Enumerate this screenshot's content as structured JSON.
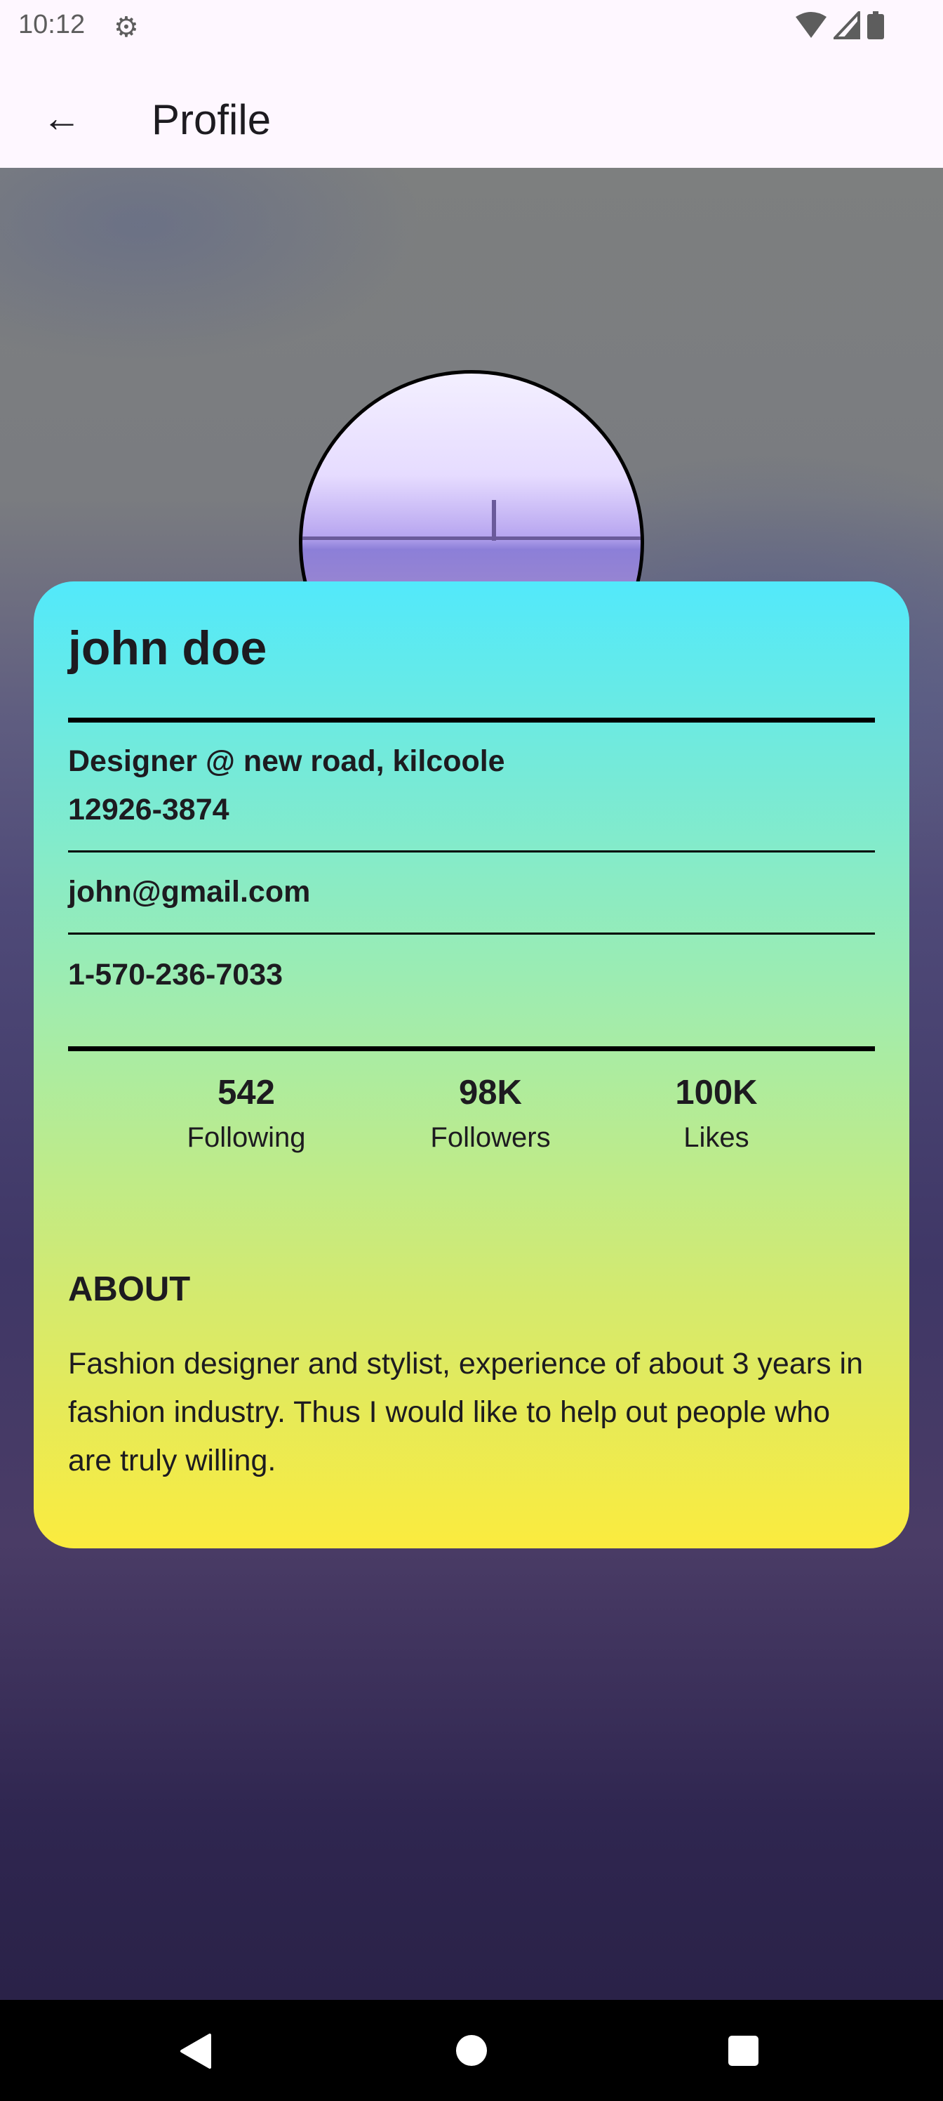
{
  "status_bar": {
    "time": "10:12",
    "icons": [
      "settings-icon",
      "wifi-icon",
      "signal-icon",
      "battery-icon"
    ]
  },
  "app_bar": {
    "title": "Profile",
    "back_icon": "arrow-back-icon"
  },
  "profile": {
    "name": "john doe",
    "address_line1": "Designer @ new road, kilcoole",
    "address_line2": "12926-3874",
    "email": "john@gmail.com",
    "phone": "1-570-236-7033",
    "stats": [
      {
        "value": "542",
        "label": "Following"
      },
      {
        "value": "98K",
        "label": "Followers"
      },
      {
        "value": "100K",
        "label": "Likes"
      }
    ],
    "about_heading": "ABOUT",
    "about_text": "Fashion designer and stylist, experience of about 3 years in fashion industry. Thus I would like to help out people who are truly willing."
  },
  "colors": {
    "card_gradient_top": "#52e9fb",
    "card_gradient_bottom": "#fbeb3e",
    "app_bar": "#fef7ff"
  },
  "nav_bar": {
    "icons": [
      "back-triangle-icon",
      "home-circle-icon",
      "recents-square-icon"
    ]
  }
}
